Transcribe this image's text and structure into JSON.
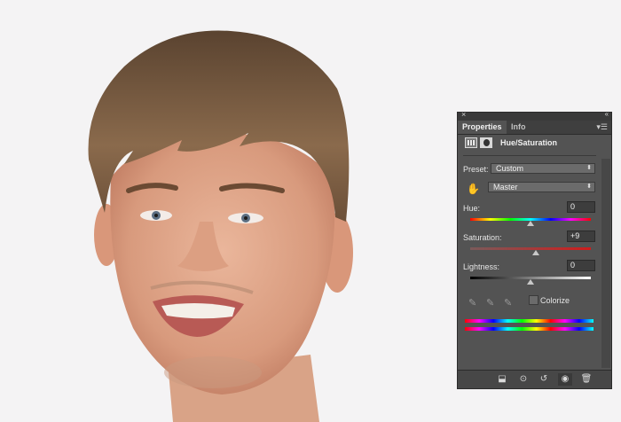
{
  "panel": {
    "tabs": [
      {
        "label": "Properties",
        "active": true
      },
      {
        "label": "Info",
        "active": false
      }
    ],
    "adjustment_title": "Hue/Saturation",
    "preset": {
      "label": "Preset:",
      "value": "Custom"
    },
    "channel": {
      "value": "Master"
    },
    "hue": {
      "label": "Hue:",
      "value": "0"
    },
    "saturation": {
      "label": "Saturation:",
      "value": "+9"
    },
    "lightness": {
      "label": "Lightness:",
      "value": "0"
    },
    "colorize": {
      "label": "Colorize",
      "checked": false
    },
    "slider_levels": {
      "hue": 0,
      "saturation": 9,
      "lightness": 0
    }
  },
  "icons": [
    "close-icon",
    "collapse-icon",
    "panel-menu-icon",
    "adjustment-layer-icon",
    "layer-mask-icon",
    "targeted-adjustment-hand-icon",
    "eyedropper-icon",
    "eyedropper-plus-icon",
    "eyedropper-minus-icon",
    "clip-to-layer-icon",
    "view-previous-icon",
    "reset-icon",
    "visibility-icon",
    "trash-icon"
  ],
  "colors": {
    "panel_bg": "#535353",
    "photo_bg": "#f4f3f4",
    "saturation_track": "#d01c1c"
  }
}
